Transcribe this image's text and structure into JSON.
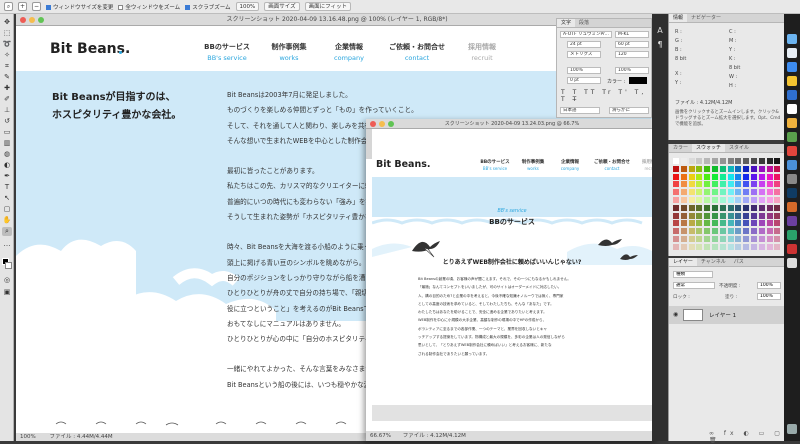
{
  "options_bar": {
    "resize_label": "ウィンドウサイズを変更",
    "all_windows_label": "全ウィンドウをズーム",
    "scrubby_label": "スクラブズーム",
    "zoom_value": "100%",
    "fit_screen_label": "画面サイズ",
    "fill_screen_label": "画面にフィット"
  },
  "doc1": {
    "title": "スクリーンショット 2020-04-09 13.16.48.png @ 100% (レイヤー 1, RGB/8*)",
    "status_zoom": "100%",
    "status_file": "ファイル : 4.44M/4.44M"
  },
  "site": {
    "logo": "Bit Beans.",
    "nav": [
      {
        "jp": "BBのサービス",
        "en": "BB's service"
      },
      {
        "jp": "制作事例集",
        "en": "works"
      },
      {
        "jp": "企業情報",
        "en": "company"
      },
      {
        "jp": "ご依頼・お問合せ",
        "en": "contact"
      },
      {
        "jp": "採用情報",
        "en": "recruit"
      }
    ],
    "heading_line1": "Bit Beansが目指すのは、",
    "heading_line2": "ホスピタリティ豊かな会社。",
    "body_lines": [
      "Bit Beansは2003年7月に発足しました。",
      "ものづくりを楽しめる仲間とずっと「もの」を作っていくこと。",
      "そして、それを通して人と関わり、楽しみを共有できる場所をつくりたい。",
      "そんな想いで生まれたWEBを中心とした制作会社です。",
      "",
      "最初に皆ったことがあります。",
      "私たちはこの先、カリスマ的なクリエイターに頼ることなく",
      "普遍的にいつの時代にも変わらない「強み」を持ち続けたい。",
      "そうして生まれた姿勢が「ホスピタリティ豊かな会社」です。",
      "",
      "時々、Bit Beansを大海を渡る小船のように乗っていきます。",
      "頭上に掲げる青い豆のシンボルを眺めながら。",
      "自分のポジションをしっかり守りながら船を漕ぎます。",
      "ひとりひとりが舟の丈で自分の持ち場で、「親切」を重ねます。",
      "役に立つということ」を考えるのがBit Beansです。",
      "おもてなしにマニュアルはありません。",
      "ひとりひとりが心の中に「自分のホスピタリティ」を持っています。",
      "",
      "一緒にやれてよかった、そんな言葉をみなさまから頂けるように。",
      "Bit Beansという船の後には、いつも穏やかな波が立っています。"
    ]
  },
  "doc2": {
    "title": "スクリーンショット 2020-04-09 13.24.03.png @ 66.7%",
    "status_zoom": "66.67%",
    "status_file": "ファイル : 4.12M/4.12M",
    "section_en": "BB's service",
    "section_jp": "BBのサービス",
    "subheading": "とりあえずWEB制作会社に頼めばいいんじゃない?",
    "body_lines": [
      "Bit Beansの創業の頃、お客様の声が聞こえます。それで、その一つにもなるかもしれません。",
      "「最適」なんてコンセプトをいいましたが、可のサイトはオーダーメイドに対応したい。",
      "人、構の目的のため?と企業の中を考えると、今後不確な知識オノルーウでは無く、専門家",
      "としての高度の技術を求めていると、そしてわたしたちも、そんな「あなた」です。",
      "わたしたちはあなたを助けることで、安全に進める企業でありたいと考えます。",
      "WEB制作を中心に小規模の大手企業、高額な制作の現場の中でHPの作成から、",
      "ボランティアに至るまでの各部作業、一つのテーマと、業界を回収しないとキャ",
      "ッチアップする提案をしています。物構成と最大の規模を、多彩の企業は人の発信しながら",
      "思いとして、「とりあえずWEB制作会社に頼めばいい」と考えるお客様に、新たな",
      "される制作会社でありたいと願っています。"
    ]
  },
  "char_panel": {
    "tabs": [
      "文字",
      "段落"
    ],
    "font": "A-OTF リュウミンPr...",
    "style": "M-KL",
    "size": "24 pt",
    "leading": "60 pt",
    "kerning": "メトリクス",
    "tracking": "120",
    "vscale": "100%",
    "hscale": "100%",
    "baseline": "0 pt",
    "color_label": "カラー :",
    "lang": "日本語",
    "aa": "滑らかに"
  },
  "nav_panel": {
    "tabs": [
      "情報",
      "ナビゲーター"
    ],
    "file": "ファイル : 4.12M/4.12M",
    "hint": "画像をクリックするとズームインします。クリック&ドラッグするとズーム拡大を選択します。Opt、Cmd で機能を追加。"
  },
  "swatch_panel": {
    "tabs": [
      "カラー",
      "スウォッチ",
      "スタイル"
    ]
  },
  "layer_panel": {
    "tabs": [
      "レイヤー",
      "チャンネル",
      "パス"
    ],
    "kind": "種類",
    "blend": "通常",
    "opacity_label": "不透明度 :",
    "opacity": "100%",
    "lock_label": "ロック :",
    "fill_label": "塗り :",
    "fill": "100%",
    "layer_name": "レイヤー 1"
  },
  "colors": {
    "sky": "#cfe9f8",
    "accent": "#2ba6de"
  }
}
